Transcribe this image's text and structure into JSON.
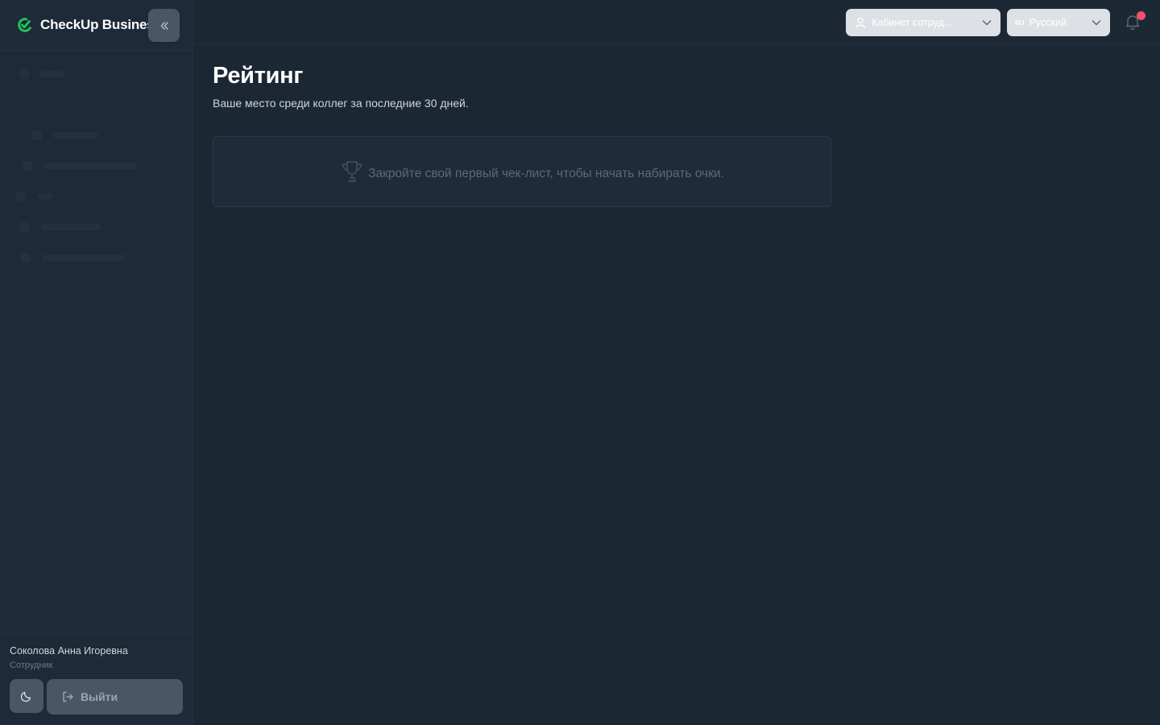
{
  "app": {
    "brand": "CheckUp Busines"
  },
  "sidebar": {
    "nav_items": [
      {
        "bar_width": 30
      },
      {
        "bar_width": 0
      },
      {
        "bar_width": 56
      },
      {
        "bar_width": 116
      },
      {
        "bar_width": 20
      },
      {
        "bar_width": 74
      },
      {
        "bar_width": 104
      }
    ],
    "user": {
      "name": "Соколова Анна Игоревна",
      "role": "Сотрудник"
    },
    "logout_label": "Выйти"
  },
  "topbar": {
    "cabinet_label": "Кабинет сотруд...",
    "language_flag": "RU",
    "language_label": "Русский"
  },
  "page": {
    "title": "Рейтинг",
    "subtitle": "Ваше место среди коллег за последние 30 дней.",
    "empty_message": "Закройте свой первый чек-лист, чтобы начать набирать очки."
  },
  "colors": {
    "accent": "#22c55e",
    "notification_badge": "#f0506e",
    "background": "#1b2733"
  }
}
